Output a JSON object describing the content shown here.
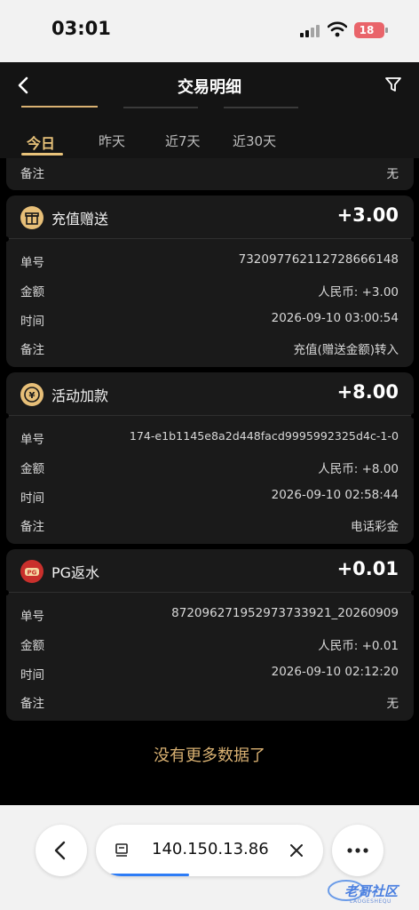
{
  "status": {
    "time": "03:01",
    "battery": "18"
  },
  "nav": {
    "title": "交易明细"
  },
  "tabs": [
    {
      "label": "今日",
      "active": true
    },
    {
      "label": "昨天",
      "active": false
    },
    {
      "label": "近7天",
      "active": false
    },
    {
      "label": "近30天",
      "active": false
    }
  ],
  "partial_row": {
    "label": "备注",
    "value": "无"
  },
  "transactions": [
    {
      "title": "充值赠送",
      "amount": "+3.00",
      "icon": "gift-icon",
      "rows": [
        {
          "label": "单号",
          "value": "7320977621127286661​48"
        },
        {
          "label": "金额",
          "value": "人民币: +3.00"
        },
        {
          "label": "时间",
          "value": "2026-09-10 03:00:54"
        },
        {
          "label": "备注",
          "value": "充值(赠送金额)转入"
        }
      ]
    },
    {
      "title": "活动加款",
      "amount": "+8.00",
      "icon": "coin-icon",
      "rows": [
        {
          "label": "单号",
          "value": "174-e1b1145e8a2d448facd9995992325d4c-1-0"
        },
        {
          "label": "金额",
          "value": "人民币: +8.00"
        },
        {
          "label": "时间",
          "value": "2026-09-10 02:58:44"
        },
        {
          "label": "备注",
          "value": "电话彩金"
        }
      ]
    },
    {
      "title": "PG返水",
      "amount": "+0.01",
      "icon": "pg-game-icon",
      "rows": [
        {
          "label": "单号",
          "value": "872096271952973733921_20260909"
        },
        {
          "label": "金额",
          "value": "人民币: +0.01"
        },
        {
          "label": "时间",
          "value": "2026-09-10 02:12:20"
        },
        {
          "label": "备注",
          "value": "无"
        }
      ]
    }
  ],
  "footer": {
    "no_more": "没有更多数据了"
  },
  "browser": {
    "address": "140.150.13.86",
    "load_progress": 0.37
  },
  "watermark": {
    "text": "老哥社区",
    "sub": "LAOGESHEQU"
  },
  "colors": {
    "accent": "#e9c37a",
    "card_bg": "#1a1a1a",
    "progress": "#2d7cf6"
  }
}
